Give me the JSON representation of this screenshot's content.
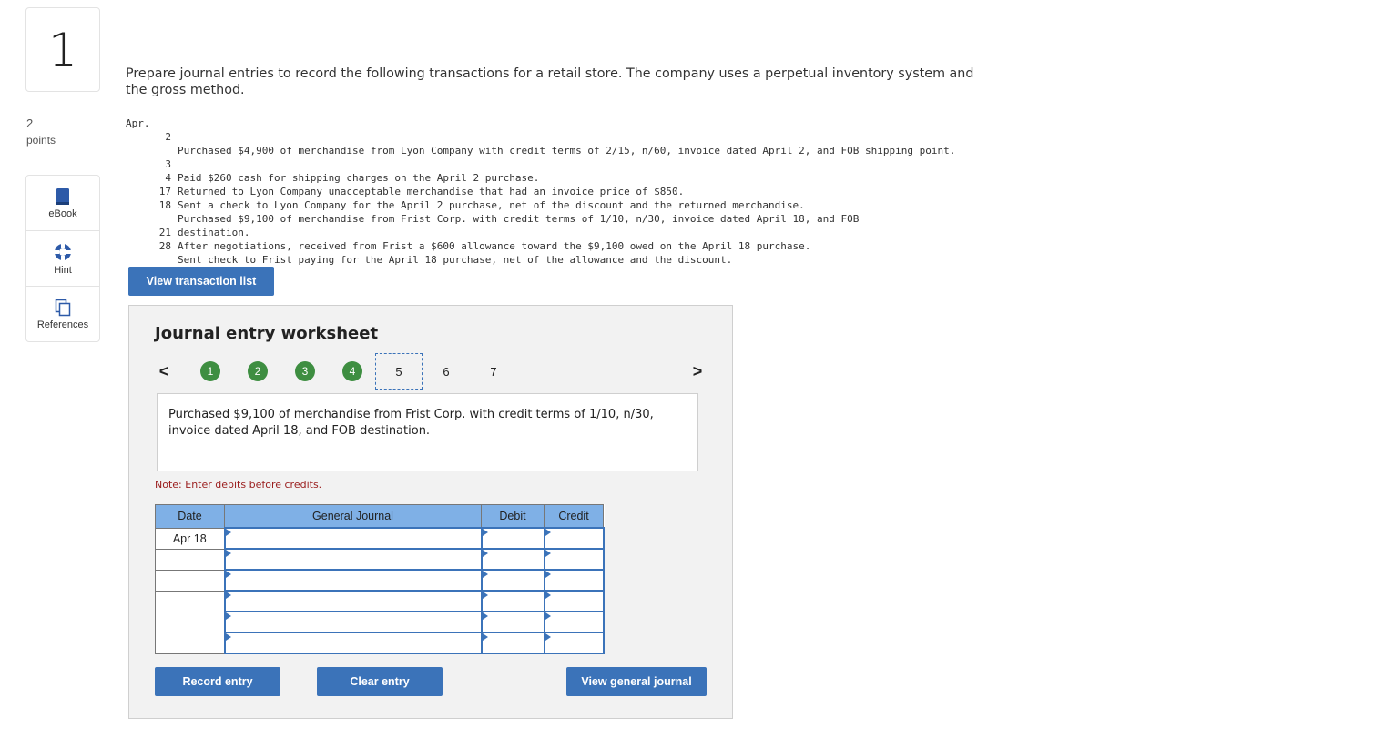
{
  "question": {
    "number": "1",
    "points_value": "2",
    "points_label": "points"
  },
  "tools": [
    {
      "label": "eBook",
      "icon": "book-icon"
    },
    {
      "label": "Hint",
      "icon": "lifebuoy-icon"
    },
    {
      "label": "References",
      "icon": "copy-icon"
    }
  ],
  "prompt": "Prepare journal entries to record the following transactions for a retail store. The company uses a perpetual inventory system and the gross method.",
  "transactions": {
    "month": "Apr.",
    "items": [
      {
        "day": "2",
        "text": "Purchased $4,900 of merchandise from Lyon Company with credit terms of 2/15, n/60, invoice dated April 2, and FOB shipping point."
      },
      {
        "day": "3",
        "text": "Paid $260 cash for shipping charges on the April 2 purchase."
      },
      {
        "day": "4",
        "text": "Returned to Lyon Company unacceptable merchandise that had an invoice price of $850."
      },
      {
        "day": "17",
        "text": "Sent a check to Lyon Company for the April 2 purchase, net of the discount and the returned merchandise."
      },
      {
        "day": "18",
        "text": "Purchased $9,100 of merchandise from Frist Corp. with credit terms of 1/10, n/30, invoice dated April 18, and FOB destination."
      },
      {
        "day": "21",
        "text": "After negotiations, received from Frist a $600 allowance toward the $9,100 owed on the April 18 purchase."
      },
      {
        "day": "28",
        "text": "Sent check to Frist paying for the April 18 purchase, net of the allowance and the discount."
      }
    ]
  },
  "buttons": {
    "view_transaction_list": "View transaction list",
    "record_entry": "Record entry",
    "clear_entry": "Clear entry",
    "view_general_journal": "View general journal"
  },
  "worksheet": {
    "title": "Journal entry worksheet",
    "steps": [
      "1",
      "2",
      "3",
      "4",
      "5",
      "6",
      "7"
    ],
    "completed_steps": 4,
    "current_step": "5",
    "prev_arrow": "<",
    "next_arrow": ">",
    "description": "Purchased $9,100 of merchandise from Frist Corp. with credit terms of 1/10, n/30, invoice dated April 18, and FOB destination.",
    "note": "Note: Enter debits before credits.",
    "table": {
      "headers": [
        "Date",
        "General Journal",
        "Debit",
        "Credit"
      ],
      "rows": [
        {
          "date": "Apr 18"
        },
        {
          "date": ""
        },
        {
          "date": ""
        },
        {
          "date": ""
        },
        {
          "date": ""
        },
        {
          "date": ""
        }
      ]
    }
  },
  "colors": {
    "button_blue": "#3b73b9",
    "step_done_green": "#3e8e41",
    "header_blue": "#7fb0e6",
    "note_red": "#9a1c1c"
  }
}
